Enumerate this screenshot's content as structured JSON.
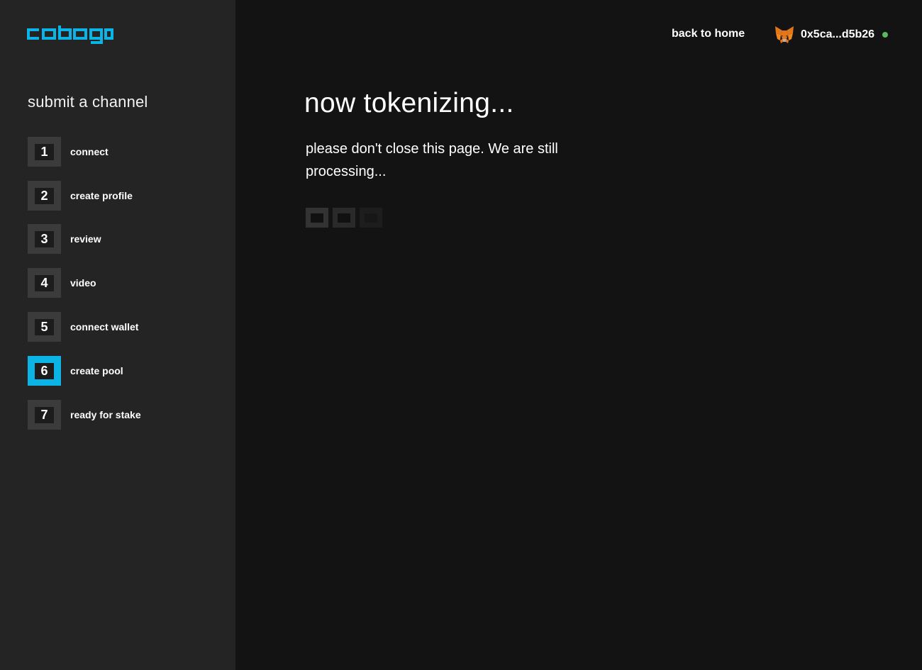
{
  "brand": {
    "name": "cobogo",
    "accent_color": "#0cb4e5",
    "icon": "cobogo-logo"
  },
  "header": {
    "back_link_label": "back to home",
    "wallet": {
      "icon": "metamask-fox-icon",
      "address": "0x5ca...d5b26",
      "status_color": "#5cb85c"
    }
  },
  "sidebar": {
    "title": "submit a channel",
    "active_step": 6,
    "steps": [
      {
        "number": "1",
        "label": "connect"
      },
      {
        "number": "2",
        "label": "create profile"
      },
      {
        "number": "3",
        "label": "review"
      },
      {
        "number": "4",
        "label": "video"
      },
      {
        "number": "5",
        "label": "connect wallet"
      },
      {
        "number": "6",
        "label": "create pool"
      },
      {
        "number": "7",
        "label": "ready for stake"
      }
    ]
  },
  "main": {
    "title": "now tokenizing...",
    "message": "please don't close this page. We are still processing..."
  }
}
